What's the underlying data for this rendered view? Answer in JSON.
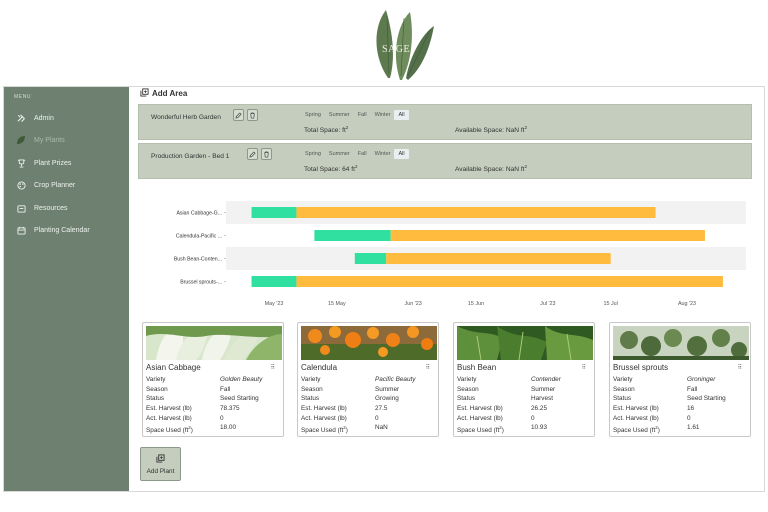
{
  "brand": {
    "logo_text": "SAGE"
  },
  "sidebar": {
    "menu_label": "MENU",
    "items": [
      {
        "label": "Admin",
        "icon": "hammer-icon"
      },
      {
        "label": "My Plants",
        "icon": "leaf-icon",
        "active": true
      },
      {
        "label": "Plant Prizes",
        "icon": "trophy-icon"
      },
      {
        "label": "Crop Planner",
        "icon": "palette-icon"
      },
      {
        "label": "Resources",
        "icon": "folder-icon"
      },
      {
        "label": "Planting Calendar",
        "icon": "calendar-icon"
      }
    ]
  },
  "main": {
    "add_area_label": "Add Area",
    "areas": [
      {
        "name": "Wonderful Herb Garden",
        "seasons": [
          "Spring",
          "Summer",
          "Fall",
          "Winter",
          "All"
        ],
        "selected_season": "All",
        "total_space_label": "Total Space: ft",
        "available_space_label": "Available Space: NaN ft"
      },
      {
        "name": "Production Garden - Bed 1",
        "seasons": [
          "Spring",
          "Summer",
          "Fall",
          "Winter",
          "All"
        ],
        "selected_season": "All",
        "total_space_label": "Total Space: 64 ft",
        "available_space_label": "Available Space: NaN ft"
      }
    ],
    "add_plant_label": "Add Plant"
  },
  "chart_data": {
    "type": "gantt",
    "x_ticks": [
      "May '23",
      "15 May",
      "Jun '23",
      "15 Jun",
      "Jul '23",
      "15 Jul",
      "Aug '23"
    ],
    "x_tick_dates": [
      "2023-05-01",
      "2023-05-15",
      "2023-06-01",
      "2023-06-15",
      "2023-07-01",
      "2023-07-15",
      "2023-08-01"
    ],
    "rows": [
      {
        "label": "Asian Cabbage-G...",
        "seed_start": "2023-04-26",
        "grow_start": "2023-05-06",
        "end": "2023-07-25"
      },
      {
        "label": "Calendula-Pacific ...",
        "seed_start": "2023-05-10",
        "grow_start": "2023-05-27",
        "end": "2023-08-05"
      },
      {
        "label": "Bush Bean-Conten...",
        "seed_start": "2023-05-19",
        "grow_start": "2023-05-26",
        "end": "2023-07-15"
      },
      {
        "label": "Brussel sprouts-...",
        "seed_start": "2023-04-26",
        "grow_start": "2023-05-06",
        "end": "2023-08-09"
      }
    ],
    "colors": {
      "seed_phase": "#2fe0a0",
      "grow_phase": "#ffbb3d",
      "row_band": "#f2f2f2"
    }
  },
  "plants": [
    {
      "name": "Asian Cabbage",
      "more": "⠿",
      "image": "cabbage",
      "rows": [
        {
          "k": "Variety",
          "v": "Golden Beauty",
          "italic": true
        },
        {
          "k": "Season",
          "v": "Fall"
        },
        {
          "k": "Status",
          "v": "Seed Starting"
        },
        {
          "k": "Est. Harvest (lb)",
          "v": "78.375"
        },
        {
          "k": "Act. Harvest (lb)",
          "v": "0"
        },
        {
          "k": "Space Used (ft",
          "sup": "2",
          "k_suffix": ")",
          "v": "18.00"
        }
      ]
    },
    {
      "name": "Calendula",
      "more": "⠿",
      "image": "calendula",
      "rows": [
        {
          "k": "Variety",
          "v": "Pacific Beauty",
          "italic": true
        },
        {
          "k": "Season",
          "v": "Summer"
        },
        {
          "k": "Status",
          "v": "Growing"
        },
        {
          "k": "Est. Harvest (lb)",
          "v": "27.5"
        },
        {
          "k": "Act. Harvest (lb)",
          "v": "0"
        },
        {
          "k": "Space Used (ft",
          "sup": "2",
          "k_suffix": ")",
          "v": "NaN"
        }
      ]
    },
    {
      "name": "Bush Bean",
      "more": "⠿",
      "image": "bean",
      "rows": [
        {
          "k": "Variety",
          "v": "Contender",
          "italic": true
        },
        {
          "k": "Season",
          "v": "Summer"
        },
        {
          "k": "Status",
          "v": "Harvest"
        },
        {
          "k": "Est. Harvest (lb)",
          "v": "26.25"
        },
        {
          "k": "Act. Harvest (lb)",
          "v": "0"
        },
        {
          "k": "Space Used (ft",
          "sup": "2",
          "k_suffix": ")",
          "v": "10.93"
        }
      ]
    },
    {
      "name": "Brussel sprouts",
      "more": "⠿",
      "image": "brussels",
      "rows": [
        {
          "k": "Variety",
          "v": "Groninger",
          "italic": true
        },
        {
          "k": "Season",
          "v": "Fall"
        },
        {
          "k": "Status",
          "v": "Seed Starting"
        },
        {
          "k": "Est. Harvest (lb)",
          "v": "16"
        },
        {
          "k": "Act. Harvest (lb)",
          "v": "0"
        },
        {
          "k": "Space Used (ft",
          "sup": "2",
          "k_suffix": ")",
          "v": "1.61"
        }
      ]
    }
  ]
}
